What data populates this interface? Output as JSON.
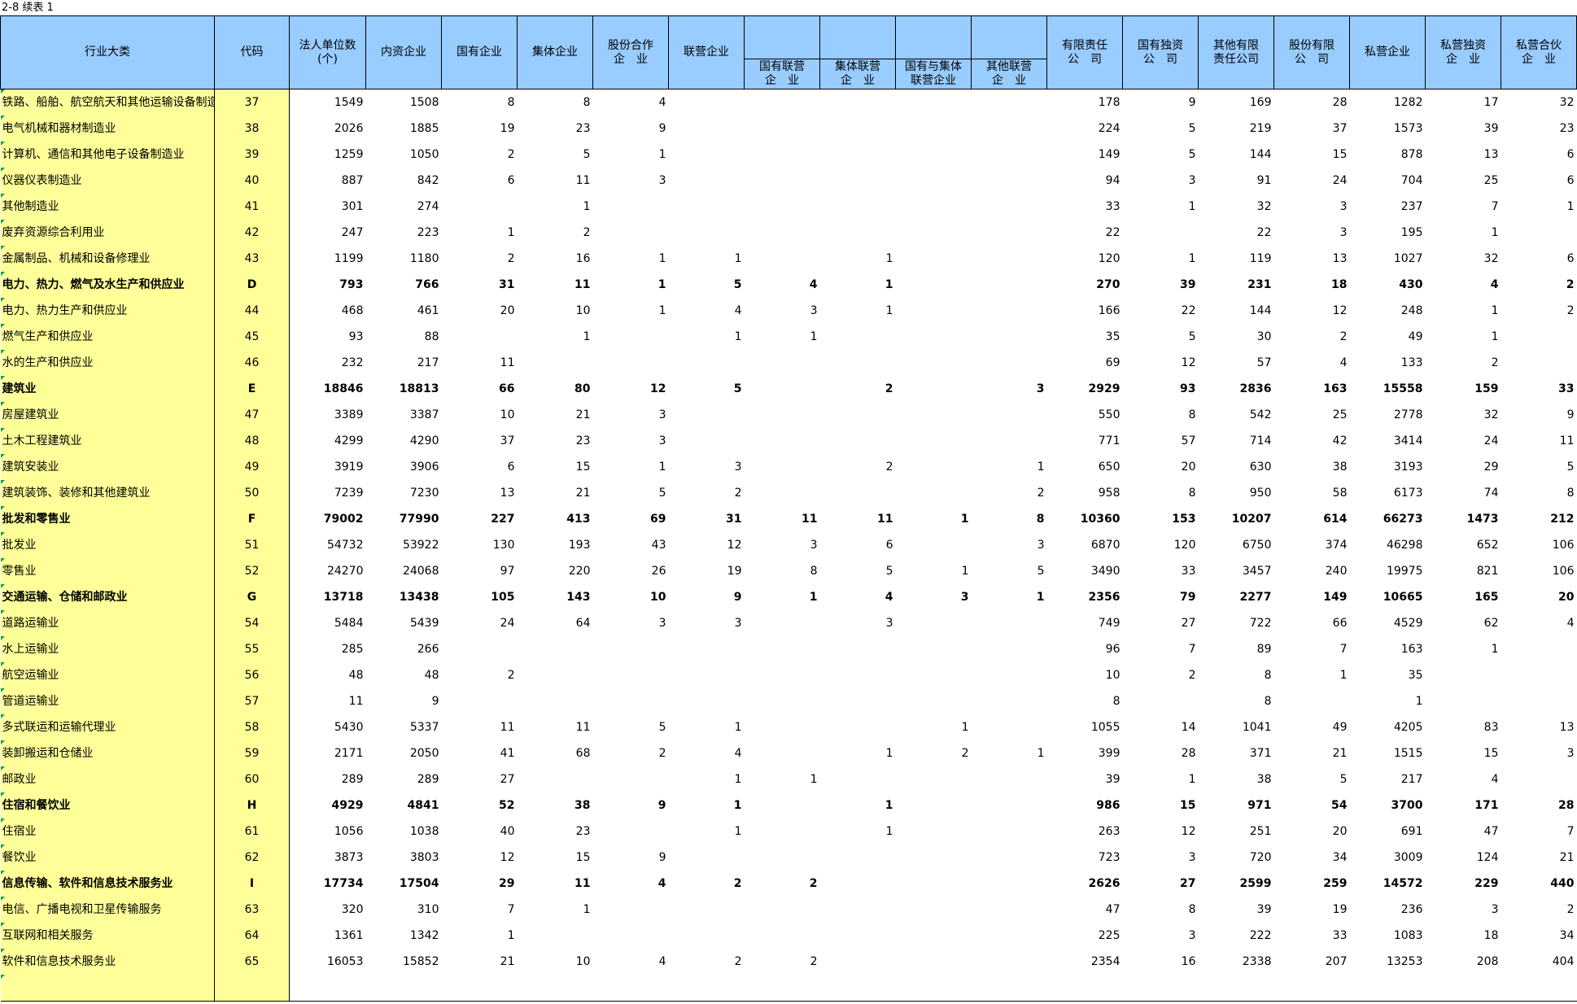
{
  "caption": "2-8  续表 1",
  "headers": {
    "industry": "行业大类",
    "code": "代码",
    "legal_units": "法人单位数\n(个)",
    "domestic": "内资企业",
    "state_owned": "国有企业",
    "collective": "集体企业",
    "joint_stock_coop": "股份合作\n企　业",
    "joint_venture": "联营企业",
    "state_jv": "国有联营\n企　业",
    "collective_jv": "集体联营\n企　业",
    "state_collective_jv": "国有与集体\n联营企业",
    "other_jv": "其他联营\n企　业",
    "limited_liability": "有限责任\n公　司",
    "state_sole": "国有独资\n公　司",
    "other_llc": "其他有限\n责任公司",
    "joint_stock_ltd": "股份有限\n公　司",
    "private": "私营企业",
    "private_sole": "私营独资\n企　业",
    "private_partnership": "私营合伙\n企　业"
  },
  "rows": [
    {
      "name": "铁路、船舶、航空航天和其他运输设备制造业",
      "code": "37",
      "bold": false,
      "v": [
        "1549",
        "1508",
        "8",
        "8",
        "4",
        "",
        "",
        "",
        "",
        "",
        "178",
        "9",
        "169",
        "28",
        "1282",
        "17",
        "32"
      ]
    },
    {
      "name": " 电气机械和器材制造业",
      "code": "38",
      "bold": false,
      "v": [
        "2026",
        "1885",
        "19",
        "23",
        "9",
        "",
        "",
        "",
        "",
        "",
        "224",
        "5",
        "219",
        "37",
        "1573",
        "39",
        "23"
      ]
    },
    {
      "name": " 计算机、通信和其他电子设备制造业",
      "code": "39",
      "bold": false,
      "v": [
        "1259",
        "1050",
        "2",
        "5",
        "1",
        "",
        "",
        "",
        "",
        "",
        "149",
        "5",
        "144",
        "15",
        "878",
        "13",
        "6"
      ]
    },
    {
      "name": " 仪器仪表制造业",
      "code": "40",
      "bold": false,
      "v": [
        "887",
        "842",
        "6",
        "11",
        "3",
        "",
        "",
        "",
        "",
        "",
        "94",
        "3",
        "91",
        "24",
        "704",
        "25",
        "6"
      ]
    },
    {
      "name": " 其他制造业",
      "code": "41",
      "bold": false,
      "v": [
        "301",
        "274",
        "",
        "1",
        "",
        "",
        "",
        "",
        "",
        "",
        "33",
        "1",
        "32",
        "3",
        "237",
        "7",
        "1"
      ]
    },
    {
      "name": " 废弃资源综合利用业",
      "code": "42",
      "bold": false,
      "v": [
        "247",
        "223",
        "1",
        "2",
        "",
        "",
        "",
        "",
        "",
        "",
        "22",
        "",
        "22",
        "3",
        "195",
        "1",
        ""
      ]
    },
    {
      "name": " 金属制品、机械和设备修理业",
      "code": "43",
      "bold": false,
      "v": [
        "1199",
        "1180",
        "2",
        "16",
        "1",
        "1",
        "",
        "1",
        "",
        "",
        "120",
        "1",
        "119",
        "13",
        "1027",
        "32",
        "6"
      ]
    },
    {
      "name": "电力、热力、燃气及水生产和供应业",
      "code": "D",
      "bold": true,
      "v": [
        "793",
        "766",
        "31",
        "11",
        "1",
        "5",
        "4",
        "1",
        "",
        "",
        "270",
        "39",
        "231",
        "18",
        "430",
        "4",
        "2"
      ]
    },
    {
      "name": " 电力、热力生产和供应业",
      "code": "44",
      "bold": false,
      "v": [
        "468",
        "461",
        "20",
        "10",
        "1",
        "4",
        "3",
        "1",
        "",
        "",
        "166",
        "22",
        "144",
        "12",
        "248",
        "1",
        "2"
      ]
    },
    {
      "name": " 燃气生产和供应业",
      "code": "45",
      "bold": false,
      "v": [
        "93",
        "88",
        "",
        "1",
        "",
        "1",
        "1",
        "",
        "",
        "",
        "35",
        "5",
        "30",
        "2",
        "49",
        "1",
        ""
      ]
    },
    {
      "name": " 水的生产和供应业",
      "code": "46",
      "bold": false,
      "v": [
        "232",
        "217",
        "11",
        "",
        "",
        "",
        "",
        "",
        "",
        "",
        "69",
        "12",
        "57",
        "4",
        "133",
        "2",
        ""
      ]
    },
    {
      "name": "建筑业",
      "code": "E",
      "bold": true,
      "v": [
        "18846",
        "18813",
        "66",
        "80",
        "12",
        "5",
        "",
        "2",
        "",
        "3",
        "2929",
        "93",
        "2836",
        "163",
        "15558",
        "159",
        "33"
      ]
    },
    {
      "name": " 房屋建筑业",
      "code": "47",
      "bold": false,
      "v": [
        "3389",
        "3387",
        "10",
        "21",
        "3",
        "",
        "",
        "",
        "",
        "",
        "550",
        "8",
        "542",
        "25",
        "2778",
        "32",
        "9"
      ]
    },
    {
      "name": " 土木工程建筑业",
      "code": "48",
      "bold": false,
      "v": [
        "4299",
        "4290",
        "37",
        "23",
        "3",
        "",
        "",
        "",
        "",
        "",
        "771",
        "57",
        "714",
        "42",
        "3414",
        "24",
        "11"
      ]
    },
    {
      "name": " 建筑安装业",
      "code": "49",
      "bold": false,
      "v": [
        "3919",
        "3906",
        "6",
        "15",
        "1",
        "3",
        "",
        "2",
        "",
        "1",
        "650",
        "20",
        "630",
        "38",
        "3193",
        "29",
        "5"
      ]
    },
    {
      "name": " 建筑装饰、装修和其他建筑业",
      "code": "50",
      "bold": false,
      "v": [
        "7239",
        "7230",
        "13",
        "21",
        "5",
        "2",
        "",
        "",
        "",
        "2",
        "958",
        "8",
        "950",
        "58",
        "6173",
        "74",
        "8"
      ]
    },
    {
      "name": "批发和零售业",
      "code": "F",
      "bold": true,
      "v": [
        "79002",
        "77990",
        "227",
        "413",
        "69",
        "31",
        "11",
        "11",
        "1",
        "8",
        "10360",
        "153",
        "10207",
        "614",
        "66273",
        "1473",
        "212"
      ]
    },
    {
      "name": " 批发业",
      "code": "51",
      "bold": false,
      "v": [
        "54732",
        "53922",
        "130",
        "193",
        "43",
        "12",
        "3",
        "6",
        "",
        "3",
        "6870",
        "120",
        "6750",
        "374",
        "46298",
        "652",
        "106"
      ]
    },
    {
      "name": " 零售业",
      "code": "52",
      "bold": false,
      "v": [
        "24270",
        "24068",
        "97",
        "220",
        "26",
        "19",
        "8",
        "5",
        "1",
        "5",
        "3490",
        "33",
        "3457",
        "240",
        "19975",
        "821",
        "106"
      ]
    },
    {
      "name": "交通运输、仓储和邮政业",
      "code": "G",
      "bold": true,
      "v": [
        "13718",
        "13438",
        "105",
        "143",
        "10",
        "9",
        "1",
        "4",
        "3",
        "1",
        "2356",
        "79",
        "2277",
        "149",
        "10665",
        "165",
        "20"
      ]
    },
    {
      "name": " 道路运输业",
      "code": "54",
      "bold": false,
      "v": [
        "5484",
        "5439",
        "24",
        "64",
        "3",
        "3",
        "",
        "3",
        "",
        "",
        "749",
        "27",
        "722",
        "66",
        "4529",
        "62",
        "4"
      ]
    },
    {
      "name": " 水上运输业",
      "code": "55",
      "bold": false,
      "v": [
        "285",
        "266",
        "",
        "",
        "",
        "",
        "",
        "",
        "",
        "",
        "96",
        "7",
        "89",
        "7",
        "163",
        "1",
        ""
      ]
    },
    {
      "name": " 航空运输业",
      "code": "56",
      "bold": false,
      "v": [
        "48",
        "48",
        "2",
        "",
        "",
        "",
        "",
        "",
        "",
        "",
        "10",
        "2",
        "8",
        "1",
        "35",
        "",
        ""
      ]
    },
    {
      "name": " 管道运输业",
      "code": "57",
      "bold": false,
      "v": [
        "11",
        "9",
        "",
        "",
        "",
        "",
        "",
        "",
        "",
        "",
        "8",
        "",
        "8",
        "",
        "1",
        "",
        ""
      ]
    },
    {
      "name": " 多式联运和运输代理业",
      "code": "58",
      "bold": false,
      "v": [
        "5430",
        "5337",
        "11",
        "11",
        "5",
        "1",
        "",
        "",
        "1",
        "",
        "1055",
        "14",
        "1041",
        "49",
        "4205",
        "83",
        "13"
      ]
    },
    {
      "name": " 装卸搬运和仓储业",
      "code": "59",
      "bold": false,
      "v": [
        "2171",
        "2050",
        "41",
        "68",
        "2",
        "4",
        "",
        "1",
        "2",
        "1",
        "399",
        "28",
        "371",
        "21",
        "1515",
        "15",
        "3"
      ]
    },
    {
      "name": " 邮政业",
      "code": "60",
      "bold": false,
      "v": [
        "289",
        "289",
        "27",
        "",
        "",
        "1",
        "1",
        "",
        "",
        "",
        "39",
        "1",
        "38",
        "5",
        "217",
        "4",
        ""
      ]
    },
    {
      "name": "住宿和餐饮业",
      "code": "H",
      "bold": true,
      "v": [
        "4929",
        "4841",
        "52",
        "38",
        "9",
        "1",
        "",
        "1",
        "",
        "",
        "986",
        "15",
        "971",
        "54",
        "3700",
        "171",
        "28"
      ]
    },
    {
      "name": " 住宿业",
      "code": "61",
      "bold": false,
      "v": [
        "1056",
        "1038",
        "40",
        "23",
        "",
        "1",
        "",
        "1",
        "",
        "",
        "263",
        "12",
        "251",
        "20",
        "691",
        "47",
        "7"
      ]
    },
    {
      "name": " 餐饮业",
      "code": "62",
      "bold": false,
      "v": [
        "3873",
        "3803",
        "12",
        "15",
        "9",
        "",
        "",
        "",
        "",
        "",
        "723",
        "3",
        "720",
        "34",
        "3009",
        "124",
        "21"
      ]
    },
    {
      "name": "信息传输、软件和信息技术服务业",
      "code": "I",
      "bold": true,
      "v": [
        "17734",
        "17504",
        "29",
        "11",
        "4",
        "2",
        "2",
        "",
        "",
        "",
        "2626",
        "27",
        "2599",
        "259",
        "14572",
        "229",
        "440"
      ]
    },
    {
      "name": " 电信、广播电视和卫星传输服务",
      "code": "63",
      "bold": false,
      "v": [
        "320",
        "310",
        "7",
        "1",
        "",
        "",
        "",
        "",
        "",
        "",
        "47",
        "8",
        "39",
        "19",
        "236",
        "3",
        "2"
      ]
    },
    {
      "name": " 互联网和相关服务",
      "code": "64",
      "bold": false,
      "v": [
        "1361",
        "1342",
        "1",
        "",
        "",
        "",
        "",
        "",
        "",
        "",
        "225",
        "3",
        "222",
        "33",
        "1083",
        "18",
        "34"
      ]
    },
    {
      "name": " 软件和信息技术服务业",
      "code": "65",
      "bold": false,
      "v": [
        "16053",
        "15852",
        "21",
        "10",
        "4",
        "2",
        "2",
        "",
        "",
        "",
        "2354",
        "16",
        "2338",
        "207",
        "13253",
        "208",
        "404"
      ]
    }
  ]
}
